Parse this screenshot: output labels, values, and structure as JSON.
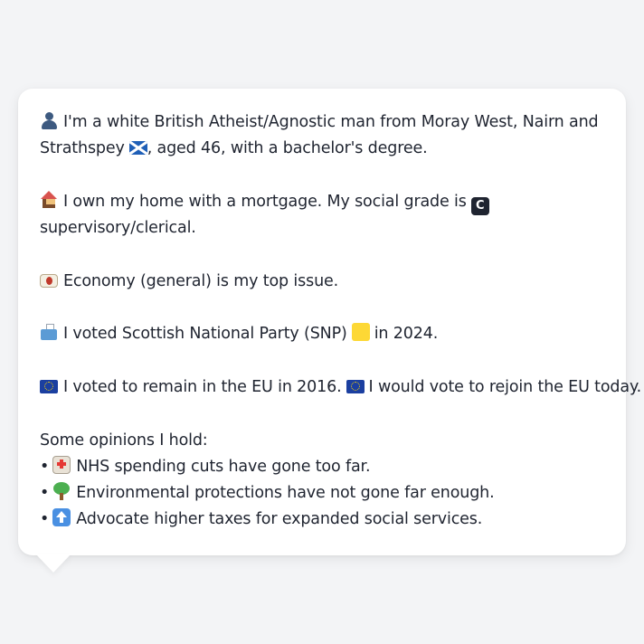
{
  "persona": {
    "intro": {
      "icon": "person-icon",
      "line1": "I'm a white British Atheist/Agnostic man from Moray West, Nairn and",
      "line2a": "Strathspey",
      "flag_icon": "flag-scotland-icon",
      "line2b": ", aged 46, with a bachelor's degree."
    },
    "home": {
      "icon": "house-icon",
      "line1": "I own my home with a mortgage. My social grade is",
      "grade_letter": "C",
      "line2": "supervisory/clerical."
    },
    "issue": {
      "icon": "money-icon",
      "text": "Economy (general) is my top issue."
    },
    "vote": {
      "icon": "ballot-box-icon",
      "text_a": "I voted Scottish National Party (SNP)",
      "party_icon": "yellow-square-icon",
      "text_b": "in 2024."
    },
    "eu": {
      "icon": "eu-flag-icon",
      "text_a": "I voted to remain in the EU in 2016.",
      "text_b": "I would vote to rejoin the EU today."
    },
    "opinions": {
      "heading": "Some opinions I hold:",
      "bullet": "•",
      "items": [
        {
          "icon": "hospital-icon",
          "text": "NHS spending cuts have gone too far."
        },
        {
          "icon": "tree-icon",
          "text": "Environmental protections have not gone far enough."
        },
        {
          "icon": "up-arrow-icon",
          "text": "Advocate higher taxes for expanded social services."
        }
      ]
    }
  },
  "colors": {
    "background": "#f3f4f6",
    "bubble": "#ffffff",
    "text": "#1f2430"
  }
}
